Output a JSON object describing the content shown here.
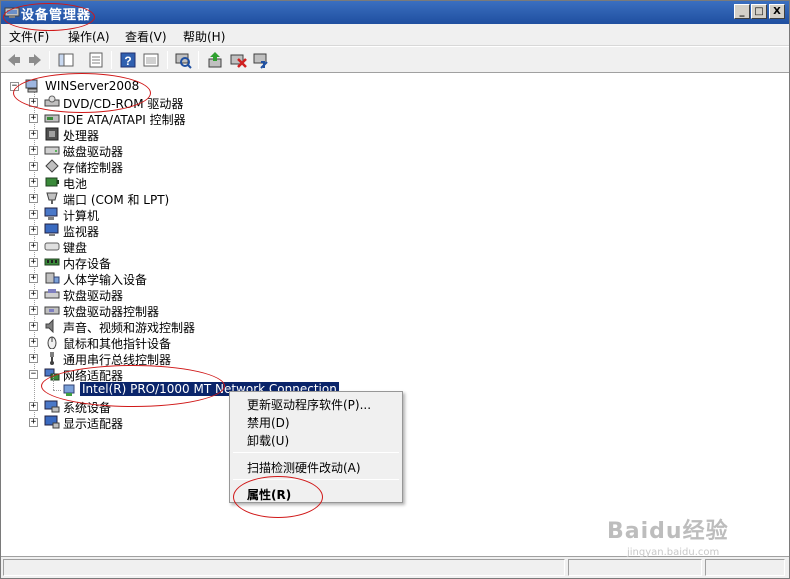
{
  "window": {
    "title": "设备管理器",
    "min": "_",
    "max": "□",
    "close": "X"
  },
  "menu": [
    "文件(F)",
    "操作(A)",
    "查看(V)",
    "帮助(H)"
  ],
  "toolbar_icons": [
    "back-icon",
    "forward-icon",
    "console-tree-icon",
    "properties-icon",
    "help-icon",
    "show-hide-icon",
    "scan-hardware-icon",
    "update-driver-icon",
    "uninstall-icon",
    "disable-icon"
  ],
  "tree": {
    "root": "WINServer2008",
    "expand_collapsed": "+",
    "expand_expanded": "−",
    "items": [
      {
        "label": "DVD/CD-ROM 驱动器",
        "icon": "dvd-drive-icon"
      },
      {
        "label": "IDE ATA/ATAPI 控制器",
        "icon": "ide-controller-icon"
      },
      {
        "label": "处理器",
        "icon": "processor-icon"
      },
      {
        "label": "磁盘驱动器",
        "icon": "disk-drive-icon"
      },
      {
        "label": "存储控制器",
        "icon": "storage-controller-icon"
      },
      {
        "label": "电池",
        "icon": "battery-icon"
      },
      {
        "label": "端口 (COM 和 LPT)",
        "icon": "port-icon"
      },
      {
        "label": "计算机",
        "icon": "computer-icon"
      },
      {
        "label": "监视器",
        "icon": "monitor-icon"
      },
      {
        "label": "键盘",
        "icon": "keyboard-icon"
      },
      {
        "label": "内存设备",
        "icon": "memory-icon"
      },
      {
        "label": "人体学输入设备",
        "icon": "hid-icon"
      },
      {
        "label": "软盘驱动器",
        "icon": "floppy-drive-icon"
      },
      {
        "label": "软盘驱动器控制器",
        "icon": "floppy-controller-icon"
      },
      {
        "label": "声音、视频和游戏控制器",
        "icon": "sound-icon"
      },
      {
        "label": "鼠标和其他指针设备",
        "icon": "mouse-icon"
      },
      {
        "label": "通用串行总线控制器",
        "icon": "usb-icon"
      },
      {
        "label": "网络适配器",
        "icon": "network-adapter-icon"
      },
      {
        "label": "系统设备",
        "icon": "system-device-icon"
      },
      {
        "label": "显示适配器",
        "icon": "display-adapter-icon"
      }
    ],
    "child": "Intel(R) PRO/1000 MT Network Connection"
  },
  "context_menu": {
    "update_driver": "更新驱动程序软件(P)...",
    "disable": "禁用(D)",
    "uninstall": "卸载(U)",
    "scan": "扫描检测硬件改动(A)",
    "properties": "属性(R)"
  },
  "watermark": {
    "brand": "Baidu经验",
    "url": "jingyan.baidu.com"
  },
  "colors": {
    "selection": "#0a246a",
    "annotation": "#d01818",
    "titlebar": "#1f4fa0"
  }
}
